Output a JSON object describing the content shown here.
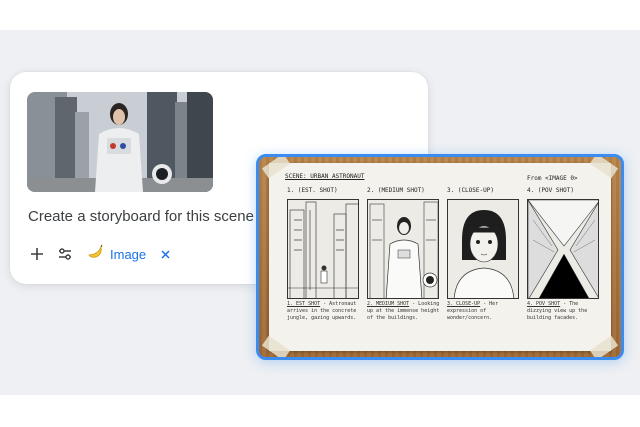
{
  "prompt": {
    "text": "Create a storyboard for this scene",
    "tools": {
      "add_icon": "plus-icon",
      "settings_icon": "sliders-icon"
    },
    "chip": {
      "icon": "banana-icon",
      "label": "Image",
      "close_icon": "close-icon"
    }
  },
  "storyboard": {
    "scene_title": "SCENE: URBAN ASTRONAUT",
    "from_label": "From <IMAGE 0>",
    "panels": [
      {
        "label": "1. (EST. SHOT)",
        "caption_title": "1. EST SHOT",
        "caption_body": " - Astronaut arrives in the concrete jungle, gazing upwards."
      },
      {
        "label": "2. (MEDIUM SHOT)",
        "caption_title": "2. MEDIUM SHOT",
        "caption_body": " - Looking up at the immense height of the buildings."
      },
      {
        "label": "3. (CLOSE-UP)",
        "caption_title": "3. CLOSE-UP",
        "caption_body": " - Her expression of wonder/concern."
      },
      {
        "label": "4. (POV SHOT)",
        "caption_title": "4. POV SHOT",
        "caption_body": " - The dizzying view up the building facades."
      }
    ]
  },
  "colors": {
    "accent": "#1a73e8",
    "frame_border": "#3b8cf0"
  }
}
